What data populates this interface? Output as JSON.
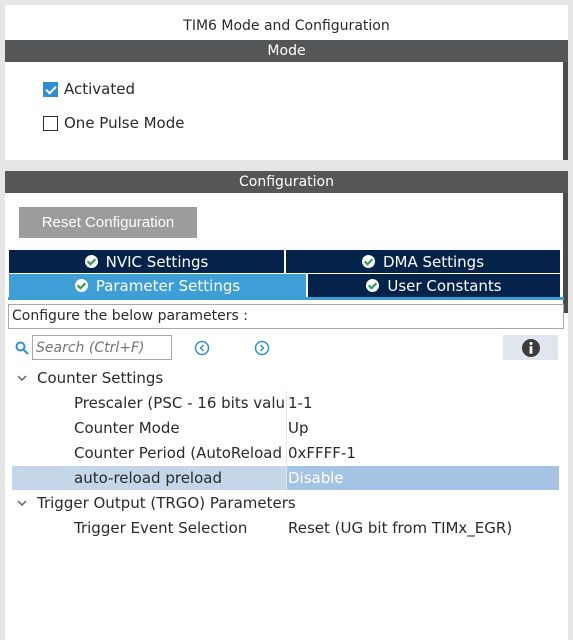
{
  "window": {
    "title": "TIM6 Mode and Configuration"
  },
  "mode": {
    "header": "Mode",
    "checkboxes": [
      {
        "label": "Activated",
        "checked": true
      },
      {
        "label": "One Pulse Mode",
        "checked": false
      }
    ]
  },
  "configuration": {
    "header": "Configuration",
    "reset_label": "Reset Configuration",
    "tabs": [
      {
        "label": "NVIC Settings",
        "active": false
      },
      {
        "label": "DMA Settings",
        "active": false
      },
      {
        "label": "Parameter Settings",
        "active": true
      },
      {
        "label": "User Constants",
        "active": false
      }
    ],
    "info_text": "Configure the below parameters :",
    "search": {
      "placeholder": "Search (Ctrl+F)"
    },
    "groups": [
      {
        "label": "Counter Settings",
        "params": [
          {
            "name": "Prescaler (PSC - 16 bits valu...",
            "value": "1-1"
          },
          {
            "name": "Counter Mode",
            "value": "Up"
          },
          {
            "name": "Counter Period (AutoReload ...",
            "value": "0xFFFF-1"
          },
          {
            "name": "auto-reload preload",
            "value": "Disable",
            "selected": true
          }
        ]
      },
      {
        "label": "Trigger Output (TRGO) Parameters",
        "params": [
          {
            "name": "Trigger Event Selection",
            "value": "Reset (UG bit from TIMx_EGR)"
          }
        ]
      }
    ]
  },
  "icons": {
    "tab_status": "check-circle-icon",
    "search": "search-icon",
    "nav_prev": "chevron-left-circle-icon",
    "nav_next": "chevron-right-circle-icon",
    "info": "info-icon",
    "expand": "chevron-down-icon"
  },
  "colors": {
    "section_header": "#555657",
    "tab_inactive": "#03234b",
    "tab_active": "#3d9fd6",
    "checkbox_checked": "#2f8fd1",
    "selected_row": "#c4d6e8",
    "button_disabled": "#9c9c9c"
  }
}
